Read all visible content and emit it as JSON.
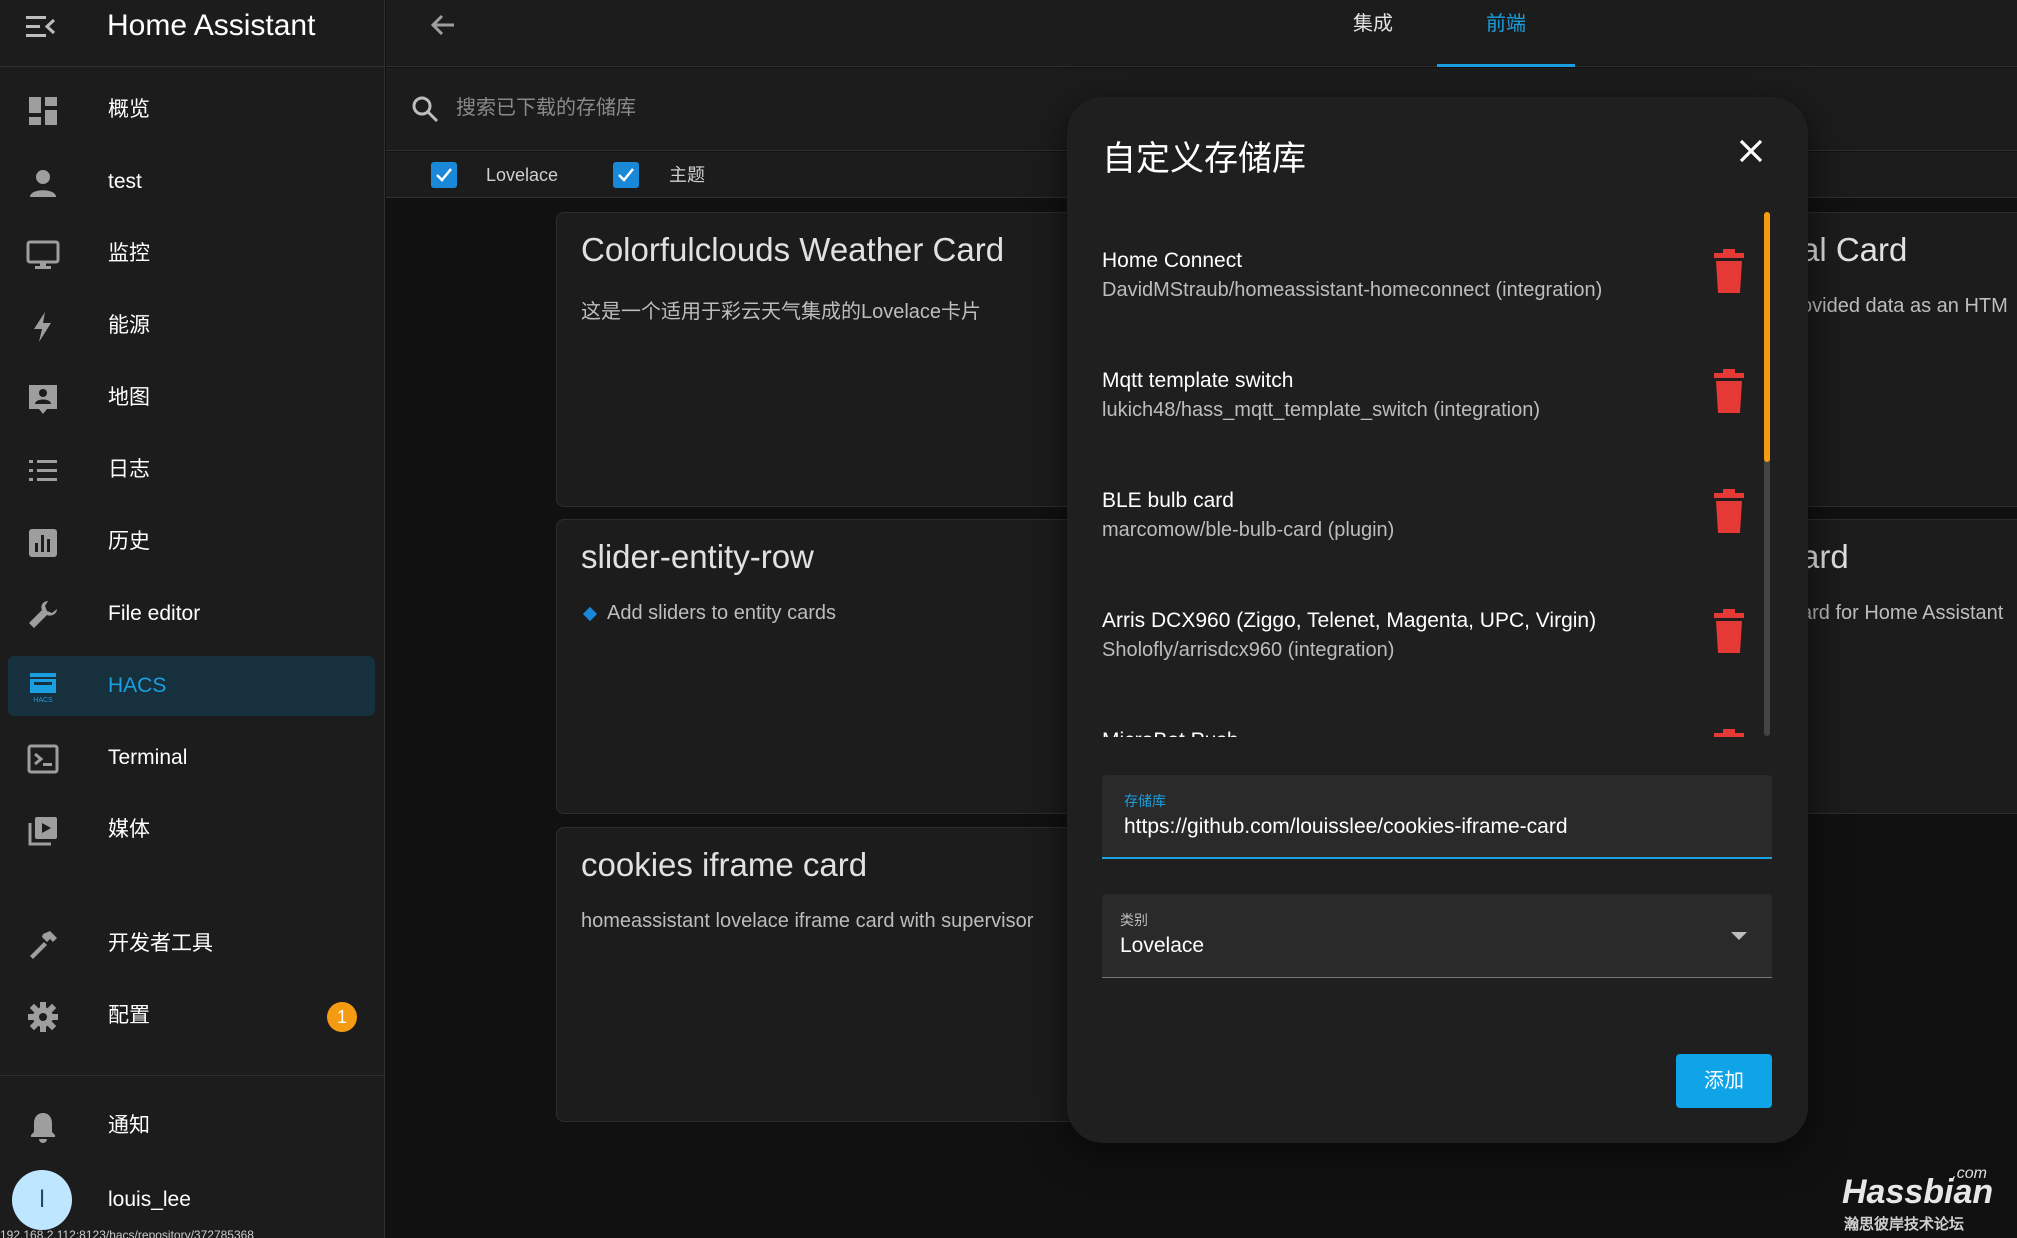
{
  "app": {
    "title": "Home Assistant"
  },
  "sidebar": {
    "items": [
      {
        "label": "概览",
        "icon": "dashboard-icon"
      },
      {
        "label": "test",
        "icon": "person-icon"
      },
      {
        "label": "监控",
        "icon": "monitor-icon"
      },
      {
        "label": "能源",
        "icon": "lightning-icon"
      },
      {
        "label": "地图",
        "icon": "map-account-icon"
      },
      {
        "label": "日志",
        "icon": "list-icon"
      },
      {
        "label": "历史",
        "icon": "chart-box-icon"
      },
      {
        "label": "File editor",
        "icon": "wrench-icon"
      },
      {
        "label": "HACS",
        "icon": "hacs-icon"
      },
      {
        "label": "Terminal",
        "icon": "console-icon"
      },
      {
        "label": "媒体",
        "icon": "play-box-icon"
      }
    ],
    "dev_tools": {
      "label": "开发者工具",
      "icon": "hammer-icon"
    },
    "config": {
      "label": "配置",
      "icon": "cog-icon",
      "badge": "1"
    },
    "notifications": {
      "label": "通知",
      "icon": "bell-icon"
    },
    "user": {
      "name": "louis_lee",
      "initial": "l"
    }
  },
  "status_url": "192.168.2.112:8123/hacs/repository/372785368",
  "tabs": [
    {
      "label": "集成"
    },
    {
      "label": "前端"
    }
  ],
  "search": {
    "placeholder": "搜索已下载的存储库"
  },
  "filters": [
    {
      "label": "Lovelace",
      "checked": true
    },
    {
      "label": "主题",
      "checked": true
    }
  ],
  "cards": [
    {
      "title": "Colorfulclouds Weather Card",
      "description": "这是一个适用于彩云天气集成的Lovelace卡片"
    },
    {
      "title": "slider-entity-row",
      "description": "Add sliders to entity cards"
    },
    {
      "title": "cookies iframe card",
      "description": "homeassistant lovelace iframe card with supervisor"
    },
    {
      "title": "al Card",
      "description": "ovided data as an HTM"
    },
    {
      "title": "ard",
      "description": "ard for Home Assistant"
    }
  ],
  "dialog": {
    "title": "自定义存储库",
    "repositories": [
      {
        "name": "Home Connect",
        "detail": "DavidMStraub/homeassistant-homeconnect (integration)"
      },
      {
        "name": "Mqtt template switch",
        "detail": "lukich48/hass_mqtt_template_switch (integration)"
      },
      {
        "name": "BLE bulb card",
        "detail": "marcomow/ble-bulb-card (plugin)"
      },
      {
        "name": "Arris DCX960 (Ziggo, Telenet, Magenta, UPC, Virgin)",
        "detail": "Sholofly/arrisdcx960 (integration)"
      },
      {
        "name": "MicroBot Push",
        "detail": ""
      }
    ],
    "repo_field": {
      "label": "存储库",
      "value": "https://github.com/louisslee/cookies-iframe-card"
    },
    "category_field": {
      "label": "类别",
      "value": "Lovelace"
    },
    "add_button": "添加"
  },
  "watermark": {
    "com": ".com",
    "main": "Hassbian",
    "sub": "瀚思彼岸技术论坛"
  },
  "colors": {
    "accent": "#1a9fe0",
    "badge": "#f49b12",
    "delete": "#e53935",
    "background": "#111111",
    "surface": "#1c1c1c"
  }
}
